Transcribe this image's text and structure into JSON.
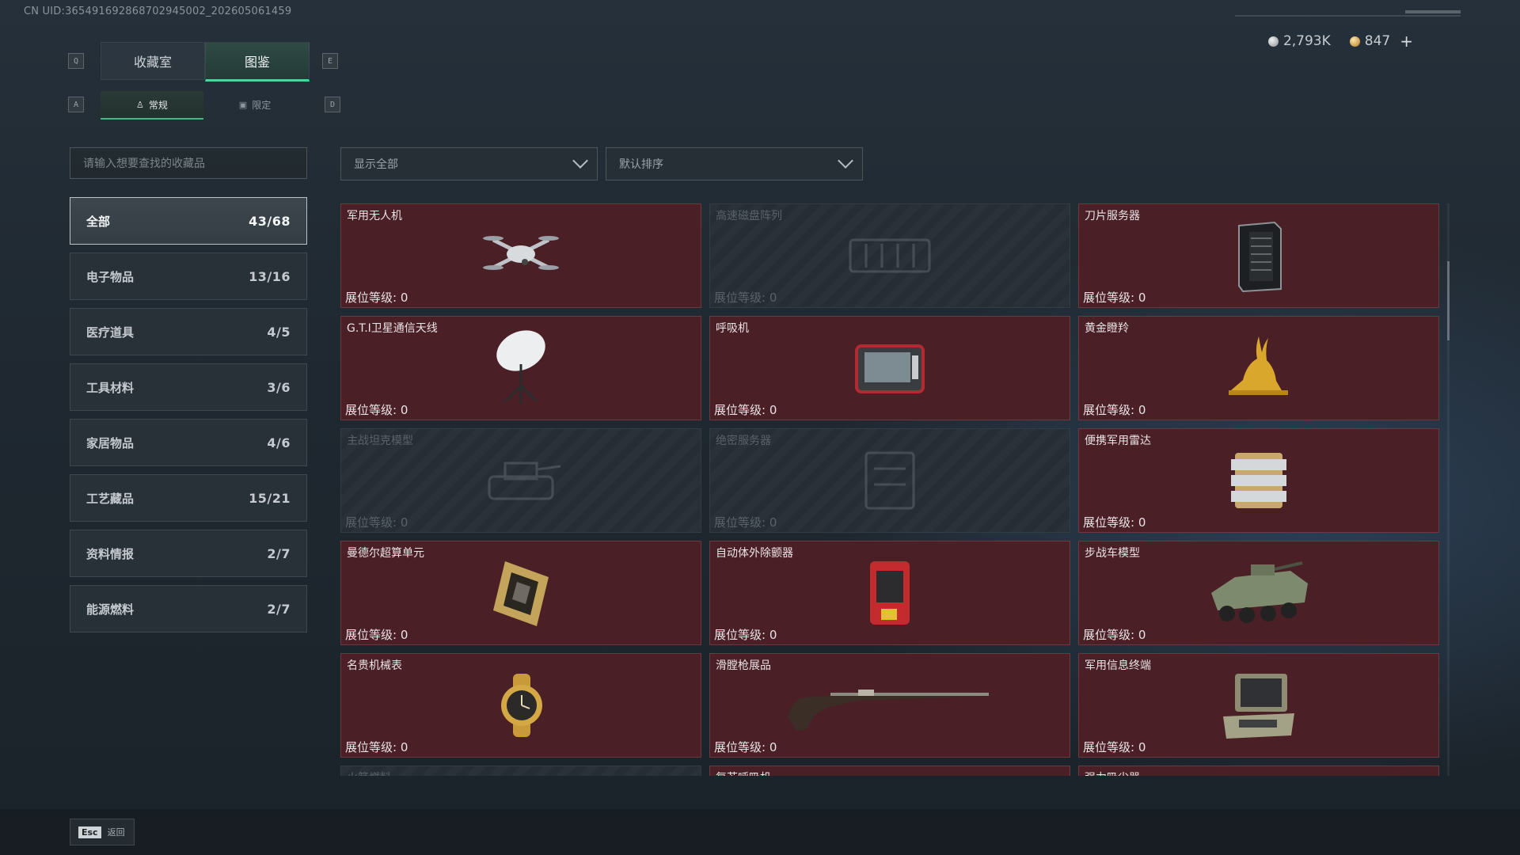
{
  "uid_text": "CN UID:365491692868702945002_202605061459",
  "currency": {
    "silver": "2,793K",
    "gold": "847",
    "plus": "+"
  },
  "keys": {
    "prev_tab": "Q",
    "next_tab": "E",
    "prev_sub": "A",
    "next_sub": "D"
  },
  "tabs": [
    {
      "label": "收藏室"
    },
    {
      "label": "图鉴"
    }
  ],
  "subtabs": [
    {
      "label": "常规"
    },
    {
      "label": "限定"
    }
  ],
  "search": {
    "placeholder": "请输入想要查找的收藏品"
  },
  "filters": {
    "show": "显示全部",
    "sort": "默认排序"
  },
  "categories": [
    {
      "label": "全部",
      "count": "43/68"
    },
    {
      "label": "电子物品",
      "count": "13/16"
    },
    {
      "label": "医疗道具",
      "count": "4/5"
    },
    {
      "label": "工具材料",
      "count": "3/6"
    },
    {
      "label": "家居物品",
      "count": "4/6"
    },
    {
      "label": "工艺藏品",
      "count": "15/21"
    },
    {
      "label": "资料情报",
      "count": "2/7"
    },
    {
      "label": "能源燃料",
      "count": "2/7"
    }
  ],
  "items": [
    {
      "name": "军用无人机",
      "level": "展位等级: 0",
      "icon": "drone-icon"
    },
    {
      "name": "高速磁盘阵列",
      "level": "展位等级: 0",
      "icon": "disk-array-icon"
    },
    {
      "name": "刀片服务器",
      "level": "展位等级: 0",
      "icon": "server-icon"
    },
    {
      "name": "G.T.I卫星通信天线",
      "level": "展位等级: 0",
      "icon": "satellite-dish-icon"
    },
    {
      "name": "呼吸机",
      "level": "展位等级: 0",
      "icon": "ventilator-icon"
    },
    {
      "name": "黄金瞪羚",
      "level": "展位等级: 0",
      "icon": "gazelle-icon"
    },
    {
      "name": "主战坦克模型",
      "level": "展位等级: 0",
      "icon": "tank-icon"
    },
    {
      "name": "绝密服务器",
      "level": "展位等级: 0",
      "icon": "secret-server-icon"
    },
    {
      "name": "便携军用雷达",
      "level": "展位等级: 0",
      "icon": "radar-icon"
    },
    {
      "name": "曼德尔超算单元",
      "level": "展位等级: 0",
      "icon": "chip-icon"
    },
    {
      "name": "自动体外除颤器",
      "level": "展位等级: 0",
      "icon": "defibrillator-icon"
    },
    {
      "name": "步战车模型",
      "level": "展位等级: 0",
      "icon": "ifv-icon"
    },
    {
      "name": "名贵机械表",
      "level": "展位等级: 0",
      "icon": "watch-icon"
    },
    {
      "name": "滑膛枪展品",
      "level": "展位等级: 0",
      "icon": "musket-icon"
    },
    {
      "name": "军用信息终端",
      "level": "展位等级: 0",
      "icon": "terminal-icon"
    },
    {
      "name": "火箭燃料",
      "level": "",
      "icon": ""
    },
    {
      "name": "复苏呼吸机",
      "level": "",
      "icon": ""
    },
    {
      "name": "强力吸尘器",
      "level": "",
      "icon": ""
    }
  ],
  "esc": {
    "key": "Esc",
    "label": "返回"
  }
}
